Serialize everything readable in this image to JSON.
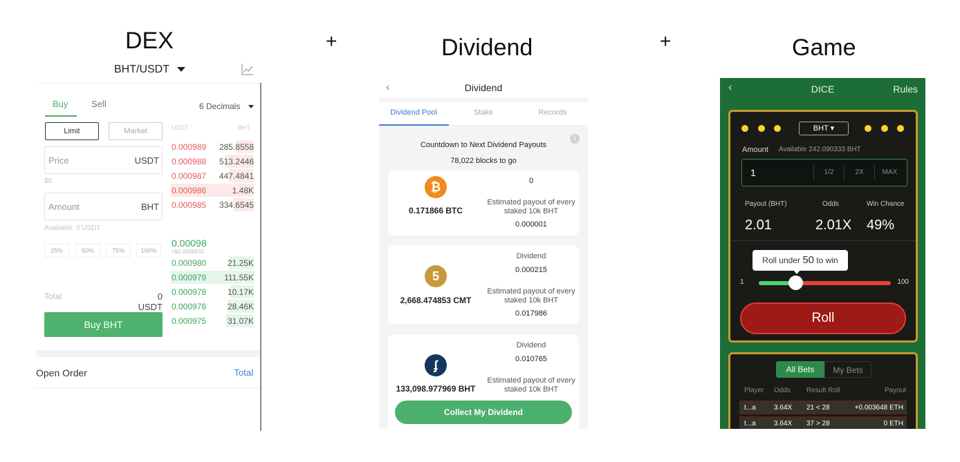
{
  "titles": {
    "dex": "DEX",
    "plus1": "+",
    "dividend": "Dividend",
    "plus2": "+",
    "game": "Game"
  },
  "dex": {
    "pair": "BHT/USDT",
    "tabs": {
      "buy": "Buy",
      "sell": "Sell"
    },
    "decimals": "6 Decimals",
    "order_types": {
      "limit": "Limit",
      "market": "Market"
    },
    "price": {
      "placeholder": "Price",
      "unit": "USDT",
      "sub": "$0"
    },
    "amount": {
      "placeholder": "Amount",
      "unit": "BHT",
      "available": "Available: 0 USDT"
    },
    "percents": [
      "25%",
      "50%",
      "75%",
      "100%"
    ],
    "total": {
      "label": "Total",
      "value": "0 USDT"
    },
    "buy_button": "Buy BHT",
    "orderbook": {
      "headers": {
        "price": "USDT",
        "qty": "BHT"
      },
      "asks": [
        {
          "price": "0.000989",
          "qty": "285.8558",
          "depth": 0.22
        },
        {
          "price": "0.000988",
          "qty": "513.2446",
          "depth": 0.35
        },
        {
          "price": "0.000987",
          "qty": "447.4841",
          "depth": 0.3
        },
        {
          "price": "0.000986",
          "qty": "1.48K",
          "depth": 1.0
        },
        {
          "price": "0.000985",
          "qty": "334.6545",
          "depth": 0.25
        }
      ],
      "last_price": "0.00098",
      "last_price_sub": "≈$0.0009832",
      "bids": [
        {
          "price": "0.000980",
          "qty": "21.25K",
          "depth": 0.3
        },
        {
          "price": "0.000979",
          "qty": "111.55K",
          "depth": 1.0
        },
        {
          "price": "0.000978",
          "qty": "10.17K",
          "depth": 0.28
        },
        {
          "price": "0.000976",
          "qty": "28.46K",
          "depth": 0.32
        },
        {
          "price": "0.000975",
          "qty": "31.07K",
          "depth": 0.33
        }
      ]
    },
    "open_order": {
      "label": "Open Order",
      "total": "Total"
    }
  },
  "dividend": {
    "back": "‹",
    "title": "Dividend",
    "tabs": [
      "Dividend Pool",
      "Stake",
      "Records"
    ],
    "countdown_title": "Countdown to Next Dividend Payouts",
    "countdown_blocks": "78,022 blocks to go",
    "info_icon": "i",
    "cards": [
      {
        "coin": "BTC",
        "coin_glyph": "₿",
        "color": "#f2891d",
        "amount": "0.171866 BTC",
        "dividend_label": "",
        "dividend_value": "0",
        "payout_label": "Estimated payout of every staked 10k BHT",
        "payout_value": "0.000001"
      },
      {
        "coin": "CMT",
        "coin_glyph": "5",
        "color": "#c69a3b",
        "amount": "2,668.474853 CMT",
        "dividend_label": "Dividend",
        "dividend_value": "0.000215",
        "payout_label": "Estimated payout of every staked 10k BHT",
        "payout_value": "0.017986"
      },
      {
        "coin": "BHT",
        "coin_glyph": "ʄ",
        "color": "#14365f",
        "amount": "133,098.977969 BHT",
        "dividend_label": "Dividend",
        "dividend_value": "0.010765",
        "payout_label": "Estimated payout of every staked 10k BHT",
        "payout_value": ""
      }
    ],
    "collect_button": "Collect My Dividend"
  },
  "game": {
    "back": "‹",
    "title": "DICE",
    "rules": "Rules",
    "token": "BHT ▾",
    "amount_label": "Amount",
    "available": "Available 242.090333 BHT",
    "amount_value": "1",
    "multipliers": [
      "1/2",
      "2X",
      "MAX"
    ],
    "stats": [
      {
        "label": "Payout (BHT)",
        "value": "2.01"
      },
      {
        "label": "Odds",
        "value": "2.01X"
      },
      {
        "label": "Win Chance",
        "value": "49%"
      }
    ],
    "tip": {
      "prefix": "Roll under",
      "number": "50",
      "suffix": "to win"
    },
    "slider": {
      "min": "1",
      "max": "100",
      "value": 50
    },
    "roll_button": "Roll",
    "bets_tabs": [
      "All Bets",
      "My Bets"
    ],
    "bets_columns": [
      "Player",
      "Odds",
      "Result Roll",
      "Payout"
    ],
    "bets_rows": [
      {
        "player": "t...a",
        "odds": "3.64X",
        "roll": "21 < 28",
        "payout": "+0.003648 ETH"
      },
      {
        "player": "t...a",
        "odds": "3.64X",
        "roll": "37 > 28",
        "payout": "0 ETH"
      }
    ]
  }
}
